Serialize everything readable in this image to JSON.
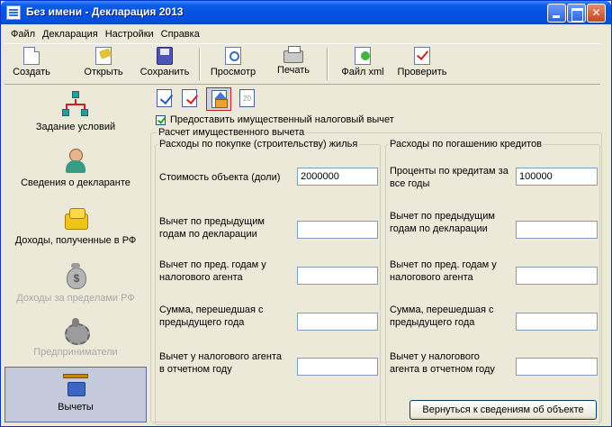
{
  "window": {
    "title": "Без имени - Декларация 2013"
  },
  "menu": [
    "Файл",
    "Декларация",
    "Настройки",
    "Справка"
  ],
  "toolbar": {
    "create": "Создать",
    "open": "Открыть",
    "save": "Сохранить",
    "preview": "Просмотр",
    "print": "Печать",
    "xml": "Файл xml",
    "check": "Проверить"
  },
  "sidebar": {
    "items": [
      {
        "label": "Задание условий",
        "icon": "tree-icon",
        "enabled": true,
        "active": false
      },
      {
        "label": "Сведения о декларанте",
        "icon": "person-icon",
        "enabled": true,
        "active": false
      },
      {
        "label": "Доходы, полученные в РФ",
        "icon": "coins-icon",
        "enabled": true,
        "active": false
      },
      {
        "label": "Доходы за пределами РФ",
        "icon": "money-bag-icon",
        "enabled": false,
        "active": false
      },
      {
        "label": "Предприниматели",
        "icon": "gear-icon",
        "enabled": false,
        "active": false
      },
      {
        "label": "Вычеты",
        "icon": "scales-icon",
        "enabled": true,
        "active": true
      }
    ]
  },
  "tab_icons": {
    "grey_label": "20"
  },
  "deduction": {
    "checkbox_label": "Предоставить имущественный налоговый вычет",
    "checked": true,
    "group_title": "Расчет имущественного вычета",
    "left_title": "Расходы по покупке (строительству) жилья",
    "right_title": "Расходы по погашению кредитов",
    "left_fields": [
      {
        "label": "Стоимость объекта (доли)",
        "value": "2000000"
      },
      {
        "label": "Вычет по предыдущим годам по декларации",
        "value": ""
      },
      {
        "label": "Вычет по пред. годам у налогового агента",
        "value": ""
      },
      {
        "label": "Сумма, перешедшая с предыдущего года",
        "value": ""
      },
      {
        "label": "Вычет у налогового агента в отчетном году",
        "value": ""
      }
    ],
    "right_fields": [
      {
        "label": "Проценты по кредитам за все годы",
        "value": "100000"
      },
      {
        "label": "Вычет по предыдущим годам по декларации",
        "value": ""
      },
      {
        "label": "Вычет по пред. годам у налогового агента",
        "value": ""
      },
      {
        "label": "Сумма, перешедшая с предыдущего года",
        "value": ""
      },
      {
        "label": "Вычет у налогового агента в отчетном году",
        "value": ""
      }
    ],
    "return_button": "Вернуться к сведениям об объекте"
  }
}
